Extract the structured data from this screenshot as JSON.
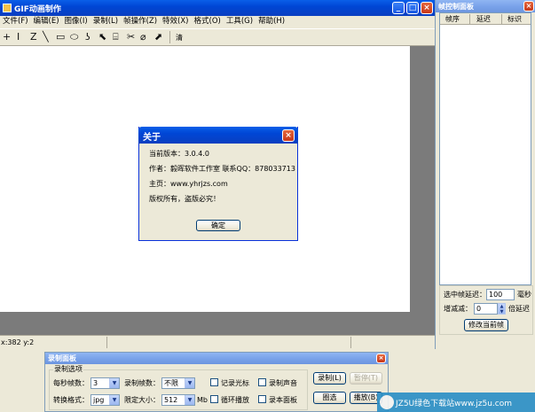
{
  "main_window": {
    "title": "GIF动画制作",
    "menu": [
      "文件(F)",
      "编辑(E)",
      "图像(I)",
      "录制(L)",
      "帧操作(Z)",
      "特效(X)",
      "格式(O)",
      "工具(G)",
      "帮助(H)"
    ],
    "tools": [
      "+",
      "I",
      "Z",
      "╲",
      "▭",
      "⬭",
      "ʖ",
      "⬉",
      "⌸",
      "✂",
      "⌀",
      "⬈"
    ],
    "clear_label": "清",
    "status_coords": "x:382 y:2"
  },
  "frame_panel": {
    "title": "帧控制面板",
    "columns": [
      "帧序",
      "延迟",
      "标识"
    ],
    "delay_label": "选中帧延迟：",
    "delay_value": "100",
    "delay_unit": "毫秒",
    "step_label": "增减减：",
    "step_value": "0",
    "step_unit": "倍延迟",
    "modify_button": "修改当前帧"
  },
  "about_dialog": {
    "title": "关于",
    "version": "当前版本：3.0.4.0",
    "author": "作者：毅晖软件工作室   联系QQ：878033713",
    "homepage": "主页：www.yhrjzs.com",
    "copyright": "版权所有，盗版必究！",
    "ok_button": "确定"
  },
  "record_panel": {
    "title": "录制面板",
    "group_label": "录制选项",
    "fps_label": "每秒帧数：",
    "fps_value": "3",
    "frames_label": "录制帧数：",
    "frames_value": "不限",
    "record_cursor": "记录光标",
    "record_sound": "录制声音",
    "format_label": "转换格式：",
    "format_value": "jpg",
    "size_label": "限定大小：",
    "size_value": "512",
    "size_unit": "Mb",
    "loop_play": "循环播放",
    "record_this_panel": "录本面板",
    "record_button": "录制(L)",
    "pause_button": "暂停(T)",
    "region_button": "圈选",
    "play_button": "播放(B)"
  },
  "watermark": "JZ5U绿色下载站www.jz5u.com"
}
